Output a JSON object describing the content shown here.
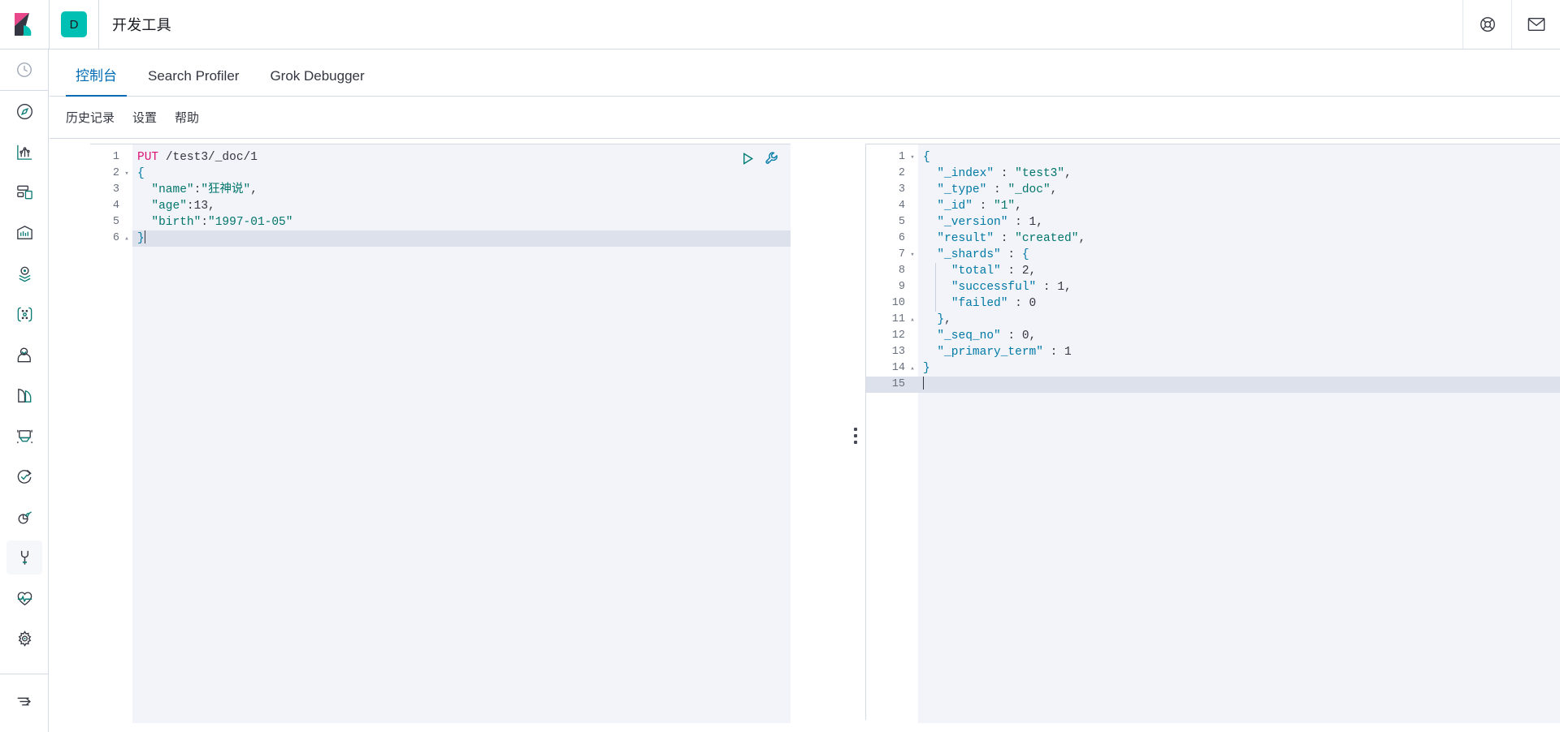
{
  "header": {
    "logo_name": "kibana-logo",
    "space_badge": "D",
    "title": "开发工具",
    "help_icon": "help-circle-icon",
    "mail_icon": "mail-icon"
  },
  "rail": {
    "items": [
      {
        "name": "recently-viewed",
        "icon": "clock-icon",
        "selected": false
      },
      {
        "name": "discover",
        "icon": "compass-icon",
        "selected": false
      },
      {
        "name": "visualize",
        "icon": "bar-chart-icon",
        "selected": false
      },
      {
        "name": "dashboard",
        "icon": "dashboard-icon",
        "selected": false
      },
      {
        "name": "canvas",
        "icon": "presentation-icon",
        "selected": false
      },
      {
        "name": "maps",
        "icon": "map-pin-layers-icon",
        "selected": false
      },
      {
        "name": "machine-learning",
        "icon": "graph-nodes-icon",
        "selected": false
      },
      {
        "name": "infrastructure",
        "icon": "user-profile-icon",
        "selected": false
      },
      {
        "name": "logs",
        "icon": "logs-icon",
        "selected": false
      },
      {
        "name": "metrics",
        "icon": "metrics-monitor-icon",
        "selected": false
      },
      {
        "name": "uptime",
        "icon": "uptime-check-icon",
        "selected": false
      },
      {
        "name": "apm",
        "icon": "apm-signal-icon",
        "selected": false
      },
      {
        "name": "dev-tools",
        "icon": "wrench-icon",
        "selected": true
      },
      {
        "name": "stack-monitoring",
        "icon": "heartbeat-icon",
        "selected": false
      },
      {
        "name": "management",
        "icon": "gear-icon",
        "selected": false
      },
      {
        "name": "collapse-nav",
        "icon": "arrow-collapse-icon",
        "selected": false
      }
    ]
  },
  "tabs": [
    {
      "label": "控制台",
      "active": true
    },
    {
      "label": "Search Profiler",
      "active": false
    },
    {
      "label": "Grok Debugger",
      "active": false
    }
  ],
  "subnav": [
    {
      "label": "历史记录"
    },
    {
      "label": "设置"
    },
    {
      "label": "帮助"
    }
  ],
  "console": {
    "actions": {
      "run_icon": "play-triangle-icon",
      "wrench_icon": "wrench-menu-icon"
    },
    "drag_handle": "panel-resize-handle",
    "request": {
      "active_line": 6,
      "lines": [
        {
          "n": "1",
          "fold": "",
          "tokens": [
            {
              "t": "PUT",
              "c": "t-method"
            },
            {
              "t": " ",
              "c": "t-plain"
            },
            {
              "t": "/test3/_doc/1",
              "c": "t-url"
            }
          ]
        },
        {
          "n": "2",
          "fold": "▾",
          "tokens": [
            {
              "t": "{",
              "c": "t-punc"
            }
          ]
        },
        {
          "n": "3",
          "fold": "",
          "tokens": [
            {
              "t": "  ",
              "c": "t-plain"
            },
            {
              "t": "\"name\"",
              "c": "t-str"
            },
            {
              "t": ":",
              "c": "t-plain"
            },
            {
              "t": "\"狂神说\"",
              "c": "t-str"
            },
            {
              "t": ",",
              "c": "t-plain"
            }
          ]
        },
        {
          "n": "4",
          "fold": "",
          "tokens": [
            {
              "t": "  ",
              "c": "t-plain"
            },
            {
              "t": "\"age\"",
              "c": "t-str"
            },
            {
              "t": ":",
              "c": "t-plain"
            },
            {
              "t": "13",
              "c": "t-num"
            },
            {
              "t": ",",
              "c": "t-plain"
            }
          ]
        },
        {
          "n": "5",
          "fold": "",
          "tokens": [
            {
              "t": "  ",
              "c": "t-plain"
            },
            {
              "t": "\"birth\"",
              "c": "t-str"
            },
            {
              "t": ":",
              "c": "t-plain"
            },
            {
              "t": "\"1997-01-05\"",
              "c": "t-str"
            }
          ]
        },
        {
          "n": "6",
          "fold": "▴",
          "tokens": [
            {
              "t": "}",
              "c": "t-punc"
            }
          ],
          "caret": true
        }
      ]
    },
    "response": {
      "active_line": 15,
      "lines": [
        {
          "n": "1",
          "fold": "▾",
          "tokens": [
            {
              "t": "{",
              "c": "t-punc"
            }
          ]
        },
        {
          "n": "2",
          "fold": "",
          "tokens": [
            {
              "t": "  ",
              "c": "t-plain"
            },
            {
              "t": "\"_index\"",
              "c": "t-key"
            },
            {
              "t": " : ",
              "c": "t-plain"
            },
            {
              "t": "\"test3\"",
              "c": "t-str"
            },
            {
              "t": ",",
              "c": "t-plain"
            }
          ]
        },
        {
          "n": "3",
          "fold": "",
          "tokens": [
            {
              "t": "  ",
              "c": "t-plain"
            },
            {
              "t": "\"_type\"",
              "c": "t-key"
            },
            {
              "t": " : ",
              "c": "t-plain"
            },
            {
              "t": "\"_doc\"",
              "c": "t-str"
            },
            {
              "t": ",",
              "c": "t-plain"
            }
          ]
        },
        {
          "n": "4",
          "fold": "",
          "tokens": [
            {
              "t": "  ",
              "c": "t-plain"
            },
            {
              "t": "\"_id\"",
              "c": "t-key"
            },
            {
              "t": " : ",
              "c": "t-plain"
            },
            {
              "t": "\"1\"",
              "c": "t-str"
            },
            {
              "t": ",",
              "c": "t-plain"
            }
          ]
        },
        {
          "n": "5",
          "fold": "",
          "tokens": [
            {
              "t": "  ",
              "c": "t-plain"
            },
            {
              "t": "\"_version\"",
              "c": "t-key"
            },
            {
              "t": " : ",
              "c": "t-plain"
            },
            {
              "t": "1",
              "c": "t-num"
            },
            {
              "t": ",",
              "c": "t-plain"
            }
          ]
        },
        {
          "n": "6",
          "fold": "",
          "tokens": [
            {
              "t": "  ",
              "c": "t-plain"
            },
            {
              "t": "\"result\"",
              "c": "t-key"
            },
            {
              "t": " : ",
              "c": "t-plain"
            },
            {
              "t": "\"created\"",
              "c": "t-str"
            },
            {
              "t": ",",
              "c": "t-plain"
            }
          ]
        },
        {
          "n": "7",
          "fold": "▾",
          "tokens": [
            {
              "t": "  ",
              "c": "t-plain"
            },
            {
              "t": "\"_shards\"",
              "c": "t-key"
            },
            {
              "t": " : ",
              "c": "t-plain"
            },
            {
              "t": "{",
              "c": "t-punc"
            }
          ]
        },
        {
          "n": "8",
          "fold": "",
          "tokens": [
            {
              "t": "    ",
              "c": "t-plain"
            },
            {
              "t": "\"total\"",
              "c": "t-key"
            },
            {
              "t": " : ",
              "c": "t-plain"
            },
            {
              "t": "2",
              "c": "t-num"
            },
            {
              "t": ",",
              "c": "t-plain"
            }
          ]
        },
        {
          "n": "9",
          "fold": "",
          "tokens": [
            {
              "t": "    ",
              "c": "t-plain"
            },
            {
              "t": "\"successful\"",
              "c": "t-key"
            },
            {
              "t": " : ",
              "c": "t-plain"
            },
            {
              "t": "1",
              "c": "t-num"
            },
            {
              "t": ",",
              "c": "t-plain"
            }
          ]
        },
        {
          "n": "10",
          "fold": "",
          "tokens": [
            {
              "t": "    ",
              "c": "t-plain"
            },
            {
              "t": "\"failed\"",
              "c": "t-key"
            },
            {
              "t": " : ",
              "c": "t-plain"
            },
            {
              "t": "0",
              "c": "t-num"
            }
          ]
        },
        {
          "n": "11",
          "fold": "▴",
          "tokens": [
            {
              "t": "  ",
              "c": "t-plain"
            },
            {
              "t": "}",
              "c": "t-punc"
            },
            {
              "t": ",",
              "c": "t-plain"
            }
          ]
        },
        {
          "n": "12",
          "fold": "",
          "tokens": [
            {
              "t": "  ",
              "c": "t-plain"
            },
            {
              "t": "\"_seq_no\"",
              "c": "t-key"
            },
            {
              "t": " : ",
              "c": "t-plain"
            },
            {
              "t": "0",
              "c": "t-num"
            },
            {
              "t": ",",
              "c": "t-plain"
            }
          ]
        },
        {
          "n": "13",
          "fold": "",
          "tokens": [
            {
              "t": "  ",
              "c": "t-plain"
            },
            {
              "t": "\"_primary_term\"",
              "c": "t-key"
            },
            {
              "t": " : ",
              "c": "t-plain"
            },
            {
              "t": "1",
              "c": "t-num"
            }
          ]
        },
        {
          "n": "14",
          "fold": "▴",
          "tokens": [
            {
              "t": "}",
              "c": "t-punc"
            }
          ]
        },
        {
          "n": "15",
          "fold": "",
          "tokens": [],
          "caret": true
        }
      ]
    }
  },
  "colors": {
    "accent_blue": "#006BB4",
    "teal": "#00BFB3",
    "pink": "#DB1374",
    "string_green": "#00756B",
    "editor_bg": "#F2F4F9",
    "active_line": "#DCE1EB",
    "border": "#D3DAE6"
  }
}
